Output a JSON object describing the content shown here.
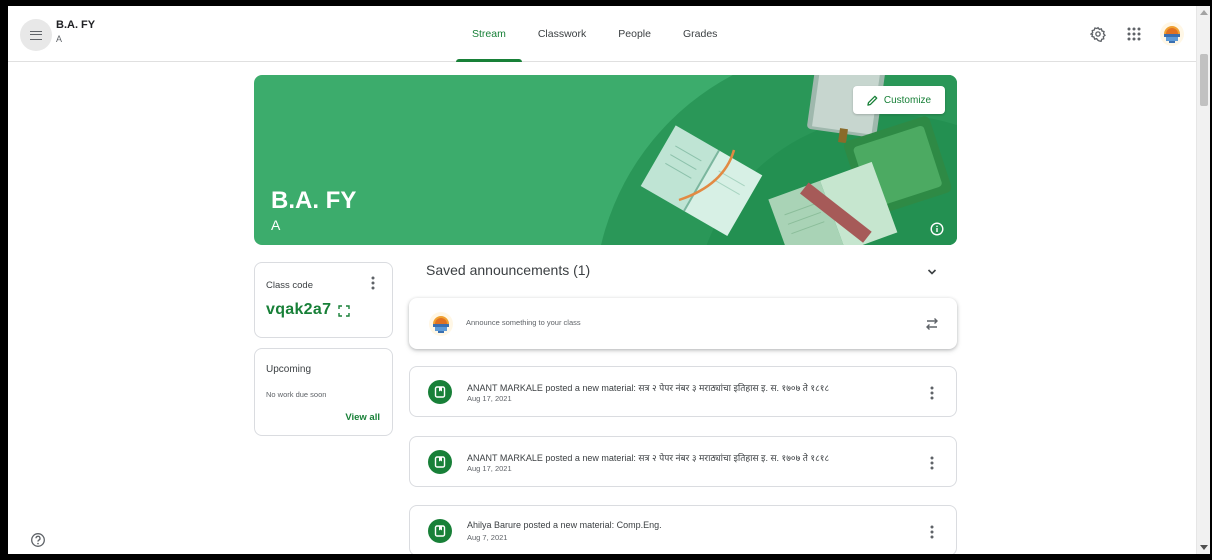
{
  "header": {
    "class_name": "B.A. FY",
    "section": "A",
    "tabs": [
      {
        "label": "Stream",
        "active": true
      },
      {
        "label": "Classwork",
        "active": false
      },
      {
        "label": "People",
        "active": false
      },
      {
        "label": "Grades",
        "active": false
      }
    ],
    "icons": [
      "settings-icon",
      "apps-grid-icon",
      "avatar"
    ]
  },
  "banner": {
    "title": "B.A. FY",
    "section": "A",
    "customize_label": "Customize",
    "color": "#3cac6c"
  },
  "class_code": {
    "label": "Class code",
    "value": "vqak2a7"
  },
  "upcoming": {
    "title": "Upcoming",
    "empty_text": "No work due soon",
    "view_all": "View all"
  },
  "stream": {
    "saved_announcements": "Saved announcements (1)",
    "announce_placeholder": "Announce something to your class",
    "posts": [
      {
        "title": "ANANT MARKALE posted a new material: सत्र २ पेपर नंबर ३ मराठ्यांचा इतिहास इ. स. १७०७ ते १८१८",
        "date": "Aug 17, 2021"
      },
      {
        "title": "ANANT MARKALE posted a new material: सत्र २ पेपर नंबर ३ मराठ्यांचा इतिहास इ. स. १७०७ ते १८१८",
        "date": "Aug 17, 2021"
      },
      {
        "title": "Ahilya Barure posted a new material: Comp.Eng.",
        "date": "Aug 7, 2021"
      }
    ]
  },
  "colors": {
    "accent": "#188038",
    "banner": "#3cac6c"
  }
}
